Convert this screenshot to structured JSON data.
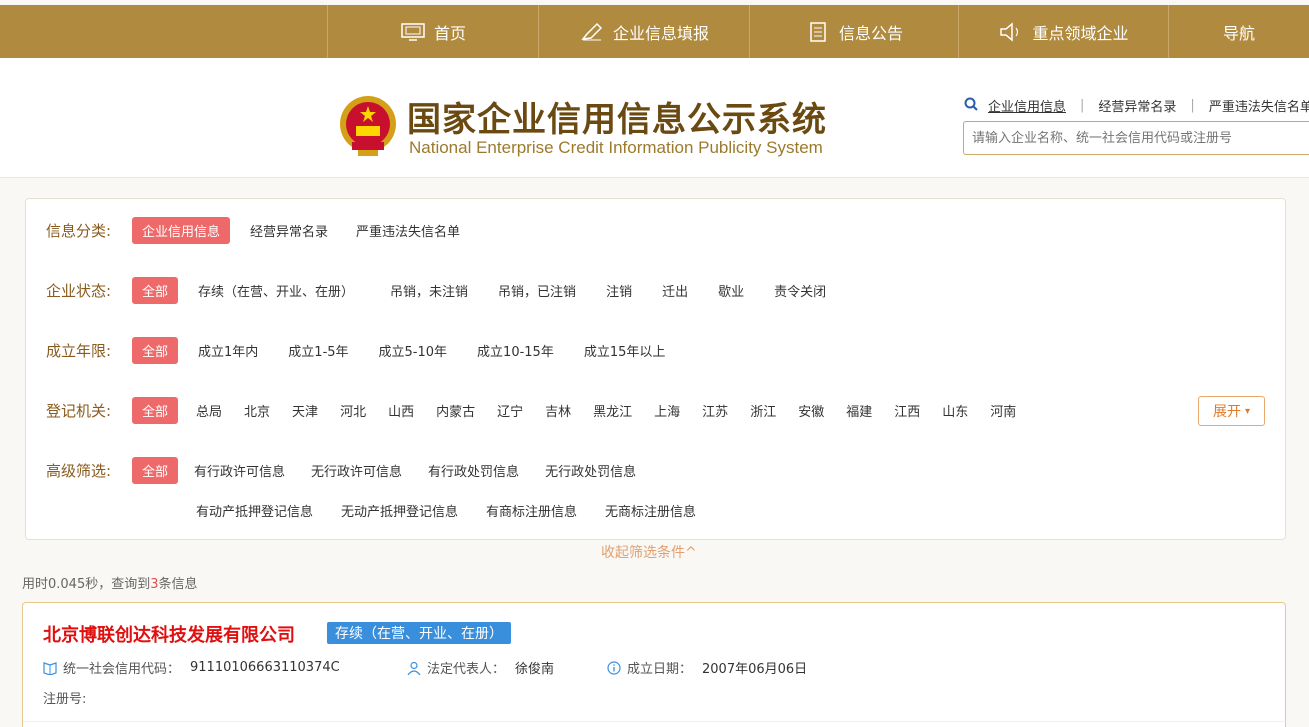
{
  "nav": {
    "items": [
      {
        "label": "首页",
        "icon": "monitor-icon"
      },
      {
        "label": "企业信息填报",
        "icon": "pen-icon"
      },
      {
        "label": "信息公告",
        "icon": "document-icon"
      },
      {
        "label": "重点领域企业",
        "icon": "speaker-icon"
      },
      {
        "label": "导航",
        "icon": ""
      }
    ]
  },
  "header": {
    "title_zh": "国家企业信用信息公示系统",
    "title_en": "National Enterprise Credit Information Publicity System",
    "search_tabs": [
      "企业信用信息",
      "经营异常名录",
      "严重违法失信名单"
    ],
    "search_placeholder": "请输入企业名称、统一社会信用代码或注册号"
  },
  "filters": {
    "category": {
      "label": "信息分类:",
      "options": [
        "企业信用信息",
        "经营异常名录",
        "严重违法失信名单"
      ]
    },
    "status": {
      "label": "企业状态:",
      "options": [
        "全部",
        "存续（在营、开业、在册）",
        "吊销，未注销",
        "吊销，已注销",
        "注销",
        "迁出",
        "歇业",
        "责令关闭"
      ]
    },
    "years": {
      "label": "成立年限:",
      "options": [
        "全部",
        "成立1年内",
        "成立1-5年",
        "成立5-10年",
        "成立10-15年",
        "成立15年以上"
      ]
    },
    "authority": {
      "label": "登记机关:",
      "options": [
        "全部",
        "总局",
        "北京",
        "天津",
        "河北",
        "山西",
        "内蒙古",
        "辽宁",
        "吉林",
        "黑龙江",
        "上海",
        "江苏",
        "浙江",
        "安徽",
        "福建",
        "江西",
        "山东",
        "河南"
      ]
    },
    "advanced": {
      "label": "高级筛选:",
      "options_row1": [
        "全部",
        "有行政许可信息",
        "无行政许可信息",
        "有行政处罚信息",
        "无行政处罚信息"
      ],
      "options_row2": [
        "有动产抵押登记信息",
        "无动产抵押登记信息",
        "有商标注册信息",
        "无商标注册信息"
      ]
    },
    "expand_label": "展开",
    "collapse_label": "收起筛选条件^"
  },
  "stats": {
    "prefix": "用时0.045秒，查询到",
    "count": "3",
    "suffix": "条信息"
  },
  "result": {
    "name": "北京博联创达科技发展有限公司",
    "status": "存续（在营、开业、在册）",
    "credit_code_label": "统一社会信用代码：",
    "credit_code": "91110106663110374C",
    "legal_rep_label": "法定代表人：",
    "legal_rep": "徐俊南",
    "founded_label": "成立日期：",
    "founded": "2007年06月06日",
    "reg_no_label": "注册号:"
  },
  "colors": {
    "nav_bg": "#b08a3e",
    "title": "#6b4a12",
    "selected_chip": "#ee6a6a",
    "status_badge": "#3a8fdd",
    "company_name": "#e01010"
  }
}
